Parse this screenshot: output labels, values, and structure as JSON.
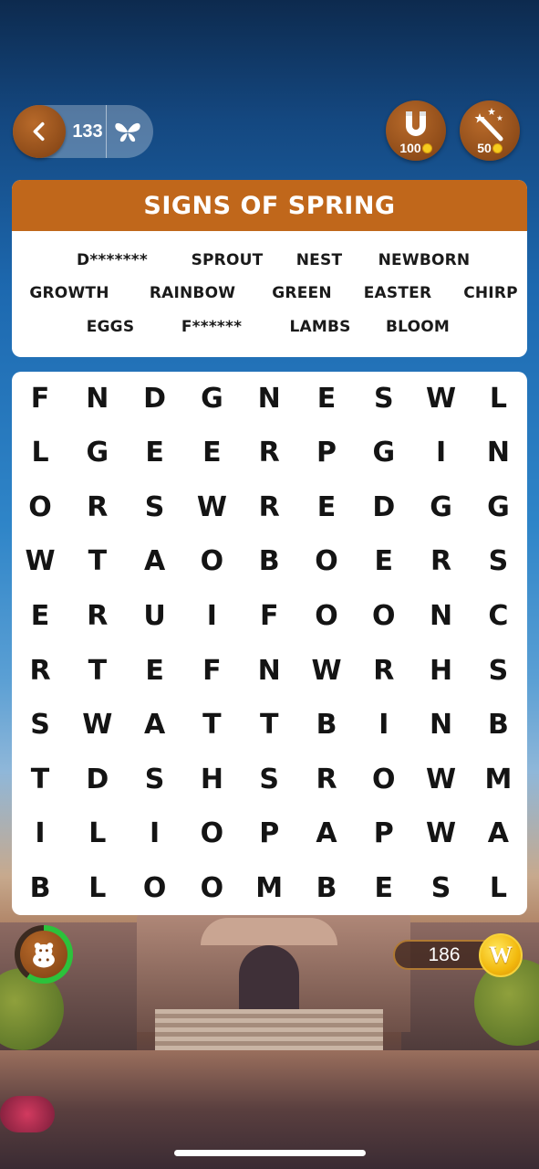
{
  "top_bar": {
    "level": "133",
    "magnet_cost": "100",
    "wand_cost": "50"
  },
  "puzzle": {
    "title": "SIGNS OF SPRING",
    "words": [
      [
        "D*******",
        "SPROUT",
        "NEST",
        "NEWBORN"
      ],
      [
        "GROWTH",
        "RAINBOW",
        "GREEN",
        "EASTER",
        "CHIRP"
      ],
      [
        "EGGS",
        "F******",
        "LAMBS",
        "BLOOM"
      ]
    ],
    "grid": [
      [
        "F",
        "N",
        "D",
        "G",
        "N",
        "E",
        "S",
        "W",
        "L"
      ],
      [
        "L",
        "G",
        "E",
        "E",
        "R",
        "P",
        "G",
        "I",
        "N"
      ],
      [
        "O",
        "R",
        "S",
        "W",
        "R",
        "E",
        "D",
        "G",
        "G"
      ],
      [
        "W",
        "T",
        "A",
        "O",
        "B",
        "O",
        "E",
        "R",
        "S"
      ],
      [
        "E",
        "R",
        "U",
        "I",
        "F",
        "O",
        "O",
        "N",
        "C"
      ],
      [
        "R",
        "T",
        "E",
        "F",
        "N",
        "W",
        "R",
        "H",
        "S"
      ],
      [
        "S",
        "W",
        "A",
        "T",
        "T",
        "B",
        "I",
        "N",
        "B"
      ],
      [
        "T",
        "D",
        "S",
        "H",
        "S",
        "R",
        "O",
        "W",
        "M"
      ],
      [
        "I",
        "L",
        "I",
        "O",
        "P",
        "A",
        "P",
        "W",
        "A"
      ],
      [
        "B",
        "L",
        "O",
        "O",
        "M",
        "B",
        "E",
        "S",
        "L"
      ]
    ]
  },
  "bottom": {
    "coins": "186",
    "coin_symbol": "W",
    "avatar_icon": "hippo-icon"
  },
  "colors": {
    "header": "#c0671b",
    "button": "#8a4a16",
    "progress": "#2cc23b",
    "coin": "#f2b90e"
  }
}
